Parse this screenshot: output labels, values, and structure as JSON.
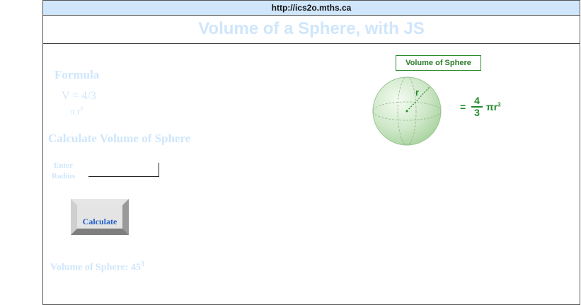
{
  "browser": {
    "url": "http://ics2o.mths.ca"
  },
  "page": {
    "title": "Volume of a Sphere, with JS",
    "formula_heading": "Formula",
    "formula_line1": "V = 4/3",
    "formula_line2_base": "π r",
    "formula_line2_exp": "3",
    "calc_heading": "Calculate Volume of Sphere",
    "enter_label_1": "Enter",
    "enter_label_2": "Radius",
    "radius_value": "",
    "calculate_button": "Calculate",
    "result_text": "Volume of Sphere: 45",
    "result_exp": "3"
  },
  "diagram": {
    "label": "Volume of Sphere",
    "radius_label": "r",
    "equals": "=",
    "numerator": "4",
    "denominator": "3",
    "pi_r": "πr",
    "exponent": "3"
  },
  "colors": {
    "pale_text": "#cfe6fb",
    "accent_green": "#1f8a2a",
    "button_text": "#1f5fc8"
  }
}
